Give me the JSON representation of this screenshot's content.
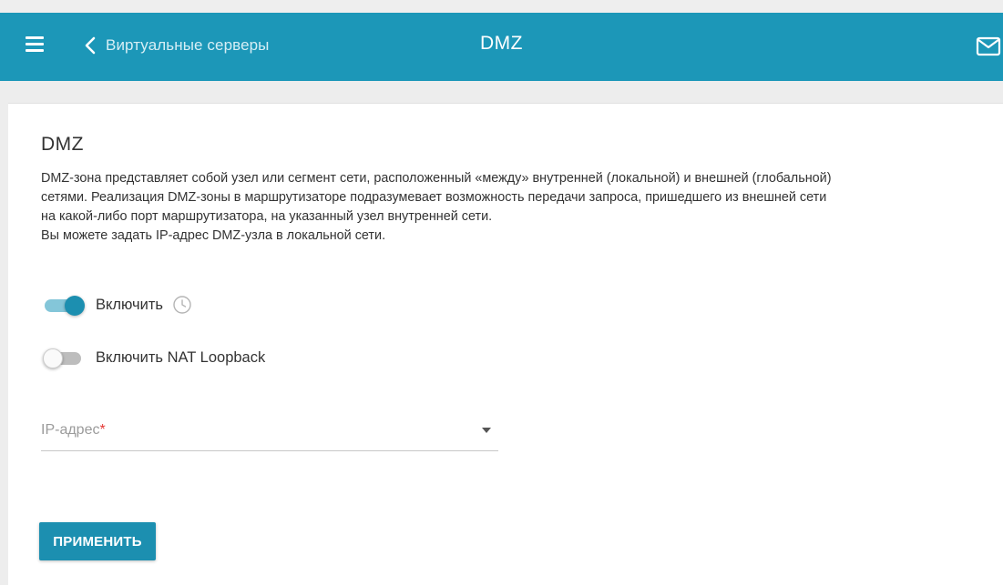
{
  "header": {
    "back_label": "Виртуальные серверы",
    "title": "DMZ",
    "icons": {
      "menu": "hamburger-menu-icon",
      "back": "chevron-left-icon",
      "notifications": "mail-icon"
    }
  },
  "section": {
    "title": "DMZ",
    "description": [
      "DMZ-зона представляет собой узел или сегмент сети, расположенный «между» внутренней (локальной) и внешней (глобальной)",
      "сетями. Реализация DMZ-зоны в маршрутизаторе подразумевает возможность передачи запроса, пришедшего из внешней сети",
      "на какой-либо порт маршрутизатора, на указанный узел внутренней сети.",
      "Вы можете задать IP-адрес DMZ-узла в локальной сети."
    ]
  },
  "toggles": {
    "enable": {
      "label": "Включить",
      "state": "on",
      "icon": "clock-icon"
    },
    "nat_loopback": {
      "label": "Включить NAT Loopback",
      "state": "off"
    }
  },
  "ip_field": {
    "label": "IP-адрес",
    "required_mark": "*",
    "value": ""
  },
  "apply_button": {
    "label": "ПРИМЕНИТЬ"
  },
  "colors": {
    "accent": "#1c97b8",
    "button": "#1c8fb0",
    "required": "#e53935"
  }
}
